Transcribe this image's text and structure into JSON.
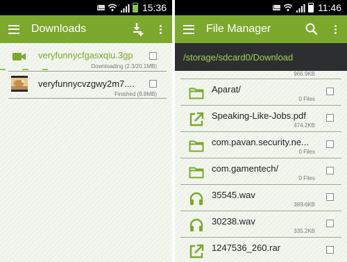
{
  "left": {
    "status_bar": {
      "time": "15:36"
    },
    "action_bar": {
      "title": "Downloads"
    },
    "downloads": [
      {
        "name": "veryfunnycfgasxqiu.3gp",
        "status": "Downloading (2.3/20.1MB)",
        "progress": 0.11,
        "icon": "video-camera-icon",
        "active": true
      },
      {
        "name": "veryfunnycvzgwy2m7....",
        "status": "Finished (8.8MB)",
        "icon": "video-thumbnail",
        "active": false
      }
    ]
  },
  "right": {
    "status_bar": {
      "time": "11:46"
    },
    "action_bar": {
      "title": "File Manager"
    },
    "path": "/storage/sdcard0/Download",
    "partial_item": {
      "meta": "966.9KB"
    },
    "files": [
      {
        "name": "Aparat/",
        "meta": "0 Files",
        "icon": "folder-icon"
      },
      {
        "name": "Speaking-Like-Jobs.pdf",
        "meta": "474.2KB",
        "icon": "open-external-icon"
      },
      {
        "name": "com.pavan.security.ne...",
        "meta": "0 Files",
        "icon": "folder-icon"
      },
      {
        "name": "com.gamentech/",
        "meta": "0 Files",
        "icon": "folder-icon"
      },
      {
        "name": "35545.wav",
        "meta": "389.6KB",
        "icon": "headphones-icon"
      },
      {
        "name": "30238.wav",
        "meta": "335.2KB",
        "icon": "headphones-icon"
      },
      {
        "name": "1247536_260.rar",
        "meta": "",
        "icon": "open-external-icon"
      }
    ]
  },
  "colors": {
    "accent": "#7ba82d",
    "path_text": "#a6cf5a",
    "active_text": "#7ba82d"
  }
}
